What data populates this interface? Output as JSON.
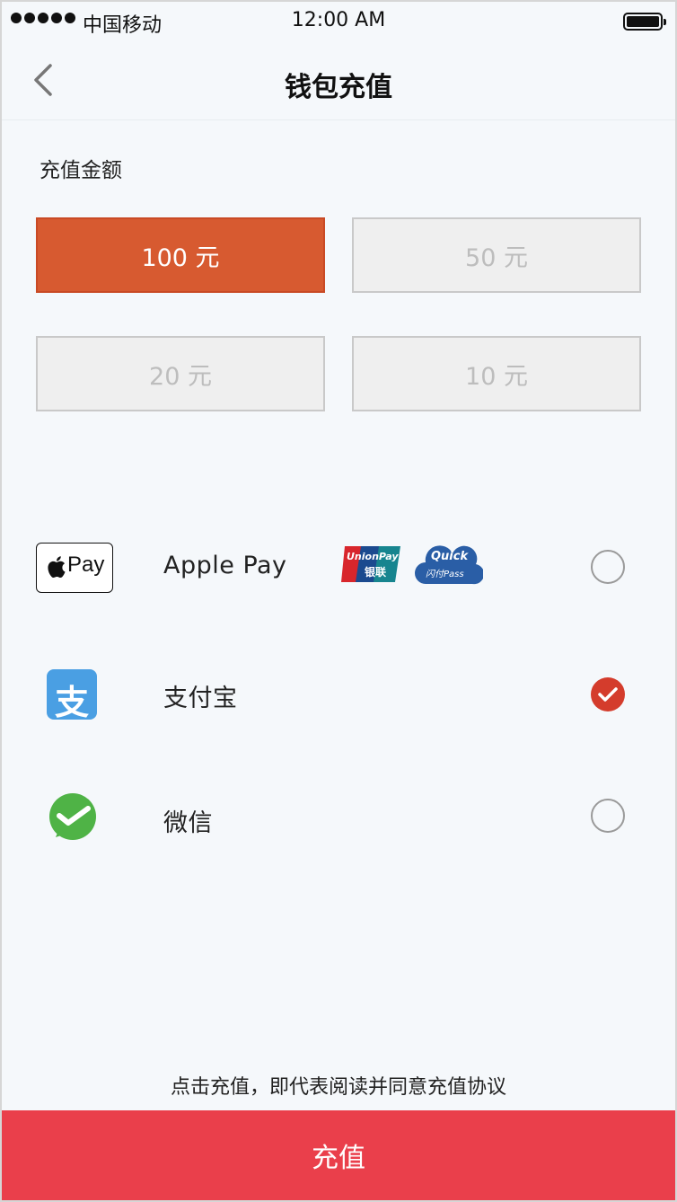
{
  "status_bar": {
    "carrier": "中国移动",
    "time": "12:00 AM"
  },
  "nav": {
    "title": "钱包充值",
    "back_icon": "chevron-left-icon"
  },
  "amount_section": {
    "label": "充值金额",
    "options": [
      {
        "label": "100 元",
        "selected": true
      },
      {
        "label": "50 元",
        "selected": false
      },
      {
        "label": "20 元",
        "selected": false
      },
      {
        "label": "10 元",
        "selected": false
      }
    ]
  },
  "payment_methods": [
    {
      "label": "Apple Pay",
      "icon": "apple-pay-icon",
      "icon_text": "Pay",
      "badges": [
        {
          "text1": "UnionPay",
          "text2": "银联"
        },
        {
          "text1": "Quick",
          "text2": "闪付Pass"
        }
      ],
      "selected": false
    },
    {
      "label": "支付宝",
      "icon": "alipay-icon",
      "icon_text": "支",
      "selected": true
    },
    {
      "label": "微信",
      "icon": "wechat-pay-icon",
      "selected": false
    }
  ],
  "agreement": {
    "prefix": "点击充值，即代表阅读并同意",
    "link": "充值协议"
  },
  "submit_label": "充值",
  "colors": {
    "selected_amount": "#d75a30",
    "submit": "#ea3f4b",
    "radio_checked": "#d43c2c",
    "alipay": "#4a9fe3",
    "wechat": "#4fb346"
  }
}
